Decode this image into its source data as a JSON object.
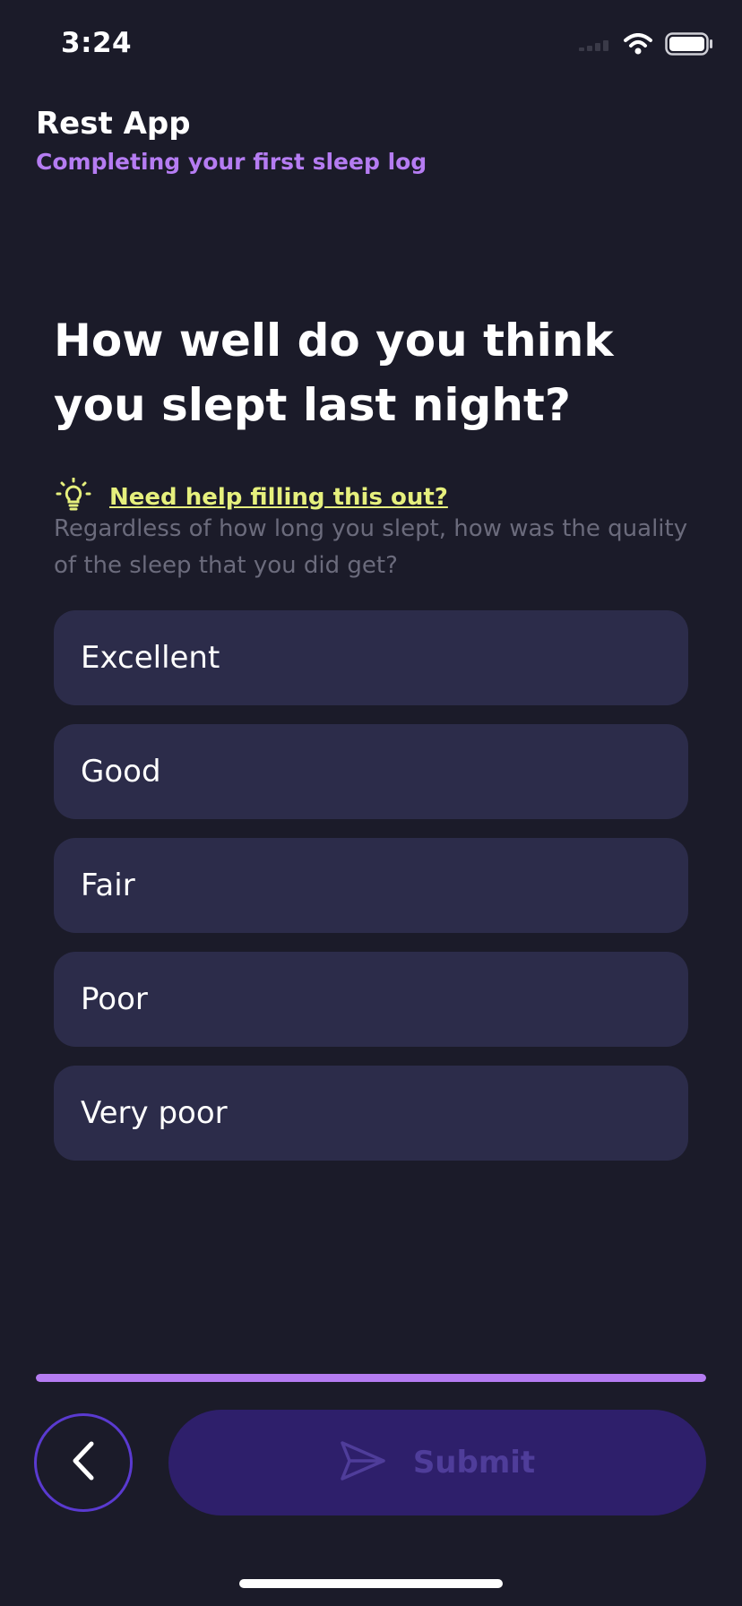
{
  "status_bar": {
    "time": "3:24"
  },
  "header": {
    "app_title": "Rest App",
    "subtitle": "Completing your first sleep log"
  },
  "question": {
    "title": "How well do you think you slept last night?",
    "help_link": "Need help filling this out?",
    "hint": "Regardless of how long you slept, how was the quality of the sleep that you did get?"
  },
  "options": [
    {
      "label": "Excellent"
    },
    {
      "label": "Good"
    },
    {
      "label": "Fair"
    },
    {
      "label": "Poor"
    },
    {
      "label": "Very poor"
    }
  ],
  "progress": {
    "fraction": 1.0
  },
  "actions": {
    "submit_label": "Submit"
  },
  "icons": {
    "help": "lightbulb-icon",
    "back": "chevron-left-icon",
    "submit": "send-icon",
    "signal": "cellular-signal-icon",
    "wifi": "wifi-icon",
    "battery": "battery-icon"
  },
  "colors": {
    "background": "#1b1b29",
    "accent": "#b57cf2",
    "help_link": "#e6f07d",
    "option_background": "#2c2c4a",
    "submit_background": "#2e1f6b",
    "submit_text": "#4f3d9a"
  }
}
